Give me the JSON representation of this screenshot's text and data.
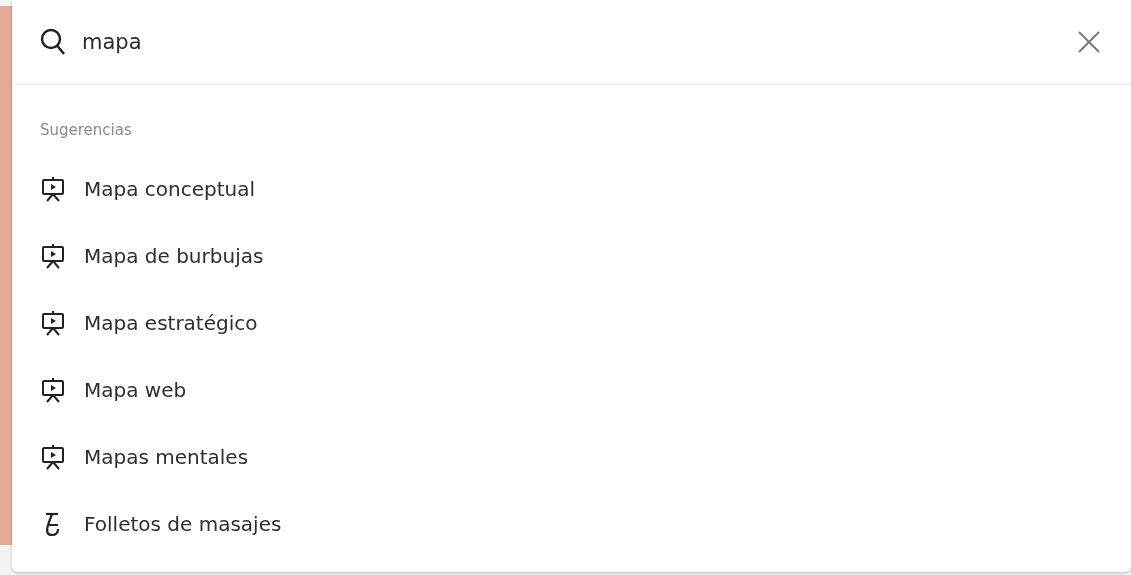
{
  "search": {
    "value": "mapa"
  },
  "suggestions": {
    "heading": "Sugerencias",
    "items": [
      {
        "label": "Mapa conceptual",
        "kind": "presentation"
      },
      {
        "label": "Mapa de burbujas",
        "kind": "presentation"
      },
      {
        "label": "Mapa estratégico",
        "kind": "presentation"
      },
      {
        "label": "Mapa web",
        "kind": "presentation"
      },
      {
        "label": "Mapas mentales",
        "kind": "presentation"
      },
      {
        "label": "Folletos de masajes",
        "kind": "figure"
      }
    ]
  }
}
